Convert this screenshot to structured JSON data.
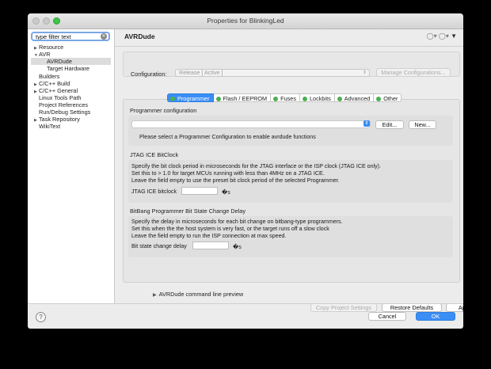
{
  "window": {
    "title": "Properties for BlinkingLed"
  },
  "sidebar": {
    "filter_value": "type filter text",
    "items": [
      {
        "label": "Resource",
        "arrow": "▶",
        "indent": 0
      },
      {
        "label": "AVR",
        "arrow": "▼",
        "indent": 0
      },
      {
        "label": "AVRDude",
        "arrow": "",
        "indent": 1,
        "selected": true
      },
      {
        "label": "Target Hardware",
        "arrow": "",
        "indent": 1
      },
      {
        "label": "Builders",
        "arrow": "",
        "indent": 0
      },
      {
        "label": "C/C++ Build",
        "arrow": "▶",
        "indent": 0
      },
      {
        "label": "C/C++ General",
        "arrow": "▶",
        "indent": 0
      },
      {
        "label": "Linux Tools Path",
        "arrow": "",
        "indent": 0
      },
      {
        "label": "Project References",
        "arrow": "",
        "indent": 0
      },
      {
        "label": "Run/Debug Settings",
        "arrow": "",
        "indent": 0
      },
      {
        "label": "Task Repository",
        "arrow": "▶",
        "indent": 0
      },
      {
        "label": "WikiText",
        "arrow": "",
        "indent": 0
      }
    ]
  },
  "main": {
    "title": "AVRDude",
    "configuration_label": "Configuration:",
    "configuration_value": "Release  [ Active ]",
    "manage_button": "Manage Configurations...",
    "tabs": [
      {
        "label": "Programmer",
        "active": true
      },
      {
        "label": "Flash / EEPROM"
      },
      {
        "label": "Fuses"
      },
      {
        "label": "Lockbits"
      },
      {
        "label": "Advanced"
      },
      {
        "label": "Other"
      }
    ],
    "programmer_config": {
      "label": "Programmer configuration",
      "edit_button": "Edit...",
      "new_button": "New...",
      "hint": "Please select a Programmer Configuration to enable avrdude functions"
    },
    "jtag": {
      "title": "JTAG ICE BitClock",
      "lines": [
        "Specify the bit clock period in microseconds for the JTAG interface or the ISP clock (JTAG ICE only).",
        "Set this to > 1.0 for target MCUs running with less than 4MHz on a JTAG ICE.",
        "Leave the field empty to use the preset bit clock period of the selected Programmer."
      ],
      "field_label": "JTAG ICE bitclock",
      "unit": "�s"
    },
    "bitbang": {
      "title": "BitBang Programmer Bit State Change Delay",
      "lines": [
        "Specify the delay in microseconds for each bit change on bitbang-type programmers.",
        "Set this when the the host system is very fast, or the target runs off a slow clock",
        "Leave the field empty to run the ISP connection at max speed."
      ],
      "field_label": "Bit state change delay",
      "unit": "�s"
    },
    "preview_label": "AVRDude command line preview",
    "copy_button": "Copy Project Settings",
    "restore_button": "Restore Defaults",
    "apply_button": "Apply"
  },
  "footer": {
    "help": "?",
    "cancel_button": "Cancel",
    "ok_button": "OK"
  }
}
